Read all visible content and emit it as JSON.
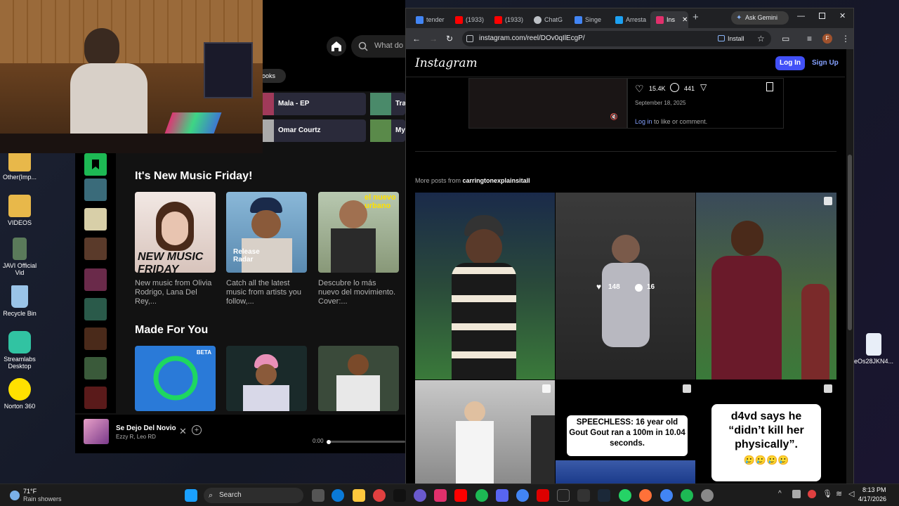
{
  "desktop": {
    "icons": [
      {
        "label": "Other(Imp...",
        "color": "#e8b84a"
      },
      {
        "label": "VIDEOS",
        "color": "#e8b84a"
      },
      {
        "label": "JAVI Official Vid",
        "color": "#5a7a5a"
      },
      {
        "label": "Recycle Bin",
        "color": "#9ac4e8"
      },
      {
        "label": "Streamlabs Desktop",
        "color": "#31c3a2"
      },
      {
        "label": "Norton 360",
        "color": "#ffe100"
      }
    ],
    "right_icon_label": "eOs28JKN4..."
  },
  "spotify": {
    "search_placeholder": "What do",
    "chip": "ooks",
    "quick": [
      {
        "label": "Mala - EP"
      },
      {
        "label": "Omar Courtz"
      },
      {
        "label": "Tra"
      },
      {
        "label": "My"
      }
    ],
    "section1": "It's New Music Friday!",
    "cards1": [
      {
        "caption": "New music from Olivia Rodrigo, Lana Del Rey,...",
        "overlay": "NEW MUSIC FRIDAY"
      },
      {
        "caption": "Catch all the latest music from artists you follow,...",
        "overlay": "Release Radar"
      },
      {
        "caption": "Descubre lo más nuevo del movimiento. Cover:...",
        "overlay": "el nuevo urbano"
      }
    ],
    "section2": "Made For You",
    "beta_label": "BETA",
    "now_playing": {
      "title": "Se Dejo Del Novio",
      "artist": "Ezzy R, Leo RD",
      "time": "0:00"
    }
  },
  "chrome": {
    "tabs": [
      {
        "label": "tender",
        "color": "#4285f4"
      },
      {
        "label": "(1933)",
        "color": "#ff0000"
      },
      {
        "label": "(1933)",
        "color": "#ff0000"
      },
      {
        "label": "ChatG",
        "color": "#bdc1c6"
      },
      {
        "label": "Singe",
        "color": "#4285f4"
      },
      {
        "label": "Arresta",
        "color": "#1da1f2"
      },
      {
        "label": "Ins",
        "color": "#e1306c"
      }
    ],
    "ask_gemini": "Ask Gemini",
    "url": "instagram.com/reel/DOv0qIlEcgP/",
    "install": "Install",
    "profile_initial": "F"
  },
  "instagram": {
    "logo": "Instagram",
    "login": "Log In",
    "signup": "Sign Up",
    "likes": "15.4K",
    "comments": "441",
    "date": "September 18, 2025",
    "login_link": "Log in",
    "login_suffix": "to like or comment.",
    "more_posts_prefix": "More posts from",
    "username": "carringtonexplainsitall",
    "hover_likes": "148",
    "hover_comments": "16",
    "post_text_1": "SPEECHLESS: 16 year old Gout Gout ran a 100m in 10.04 seconds.",
    "post_text_2": "d4vd says he “didn’t kill her physically”.",
    "post_text_2_emoji": "🥲🥲🥲🥲"
  },
  "taskbar": {
    "weather_temp": "71°F",
    "weather_desc": "Rain showers",
    "search": "Search",
    "time": "8:13 PM",
    "date": "4/17/2026"
  }
}
